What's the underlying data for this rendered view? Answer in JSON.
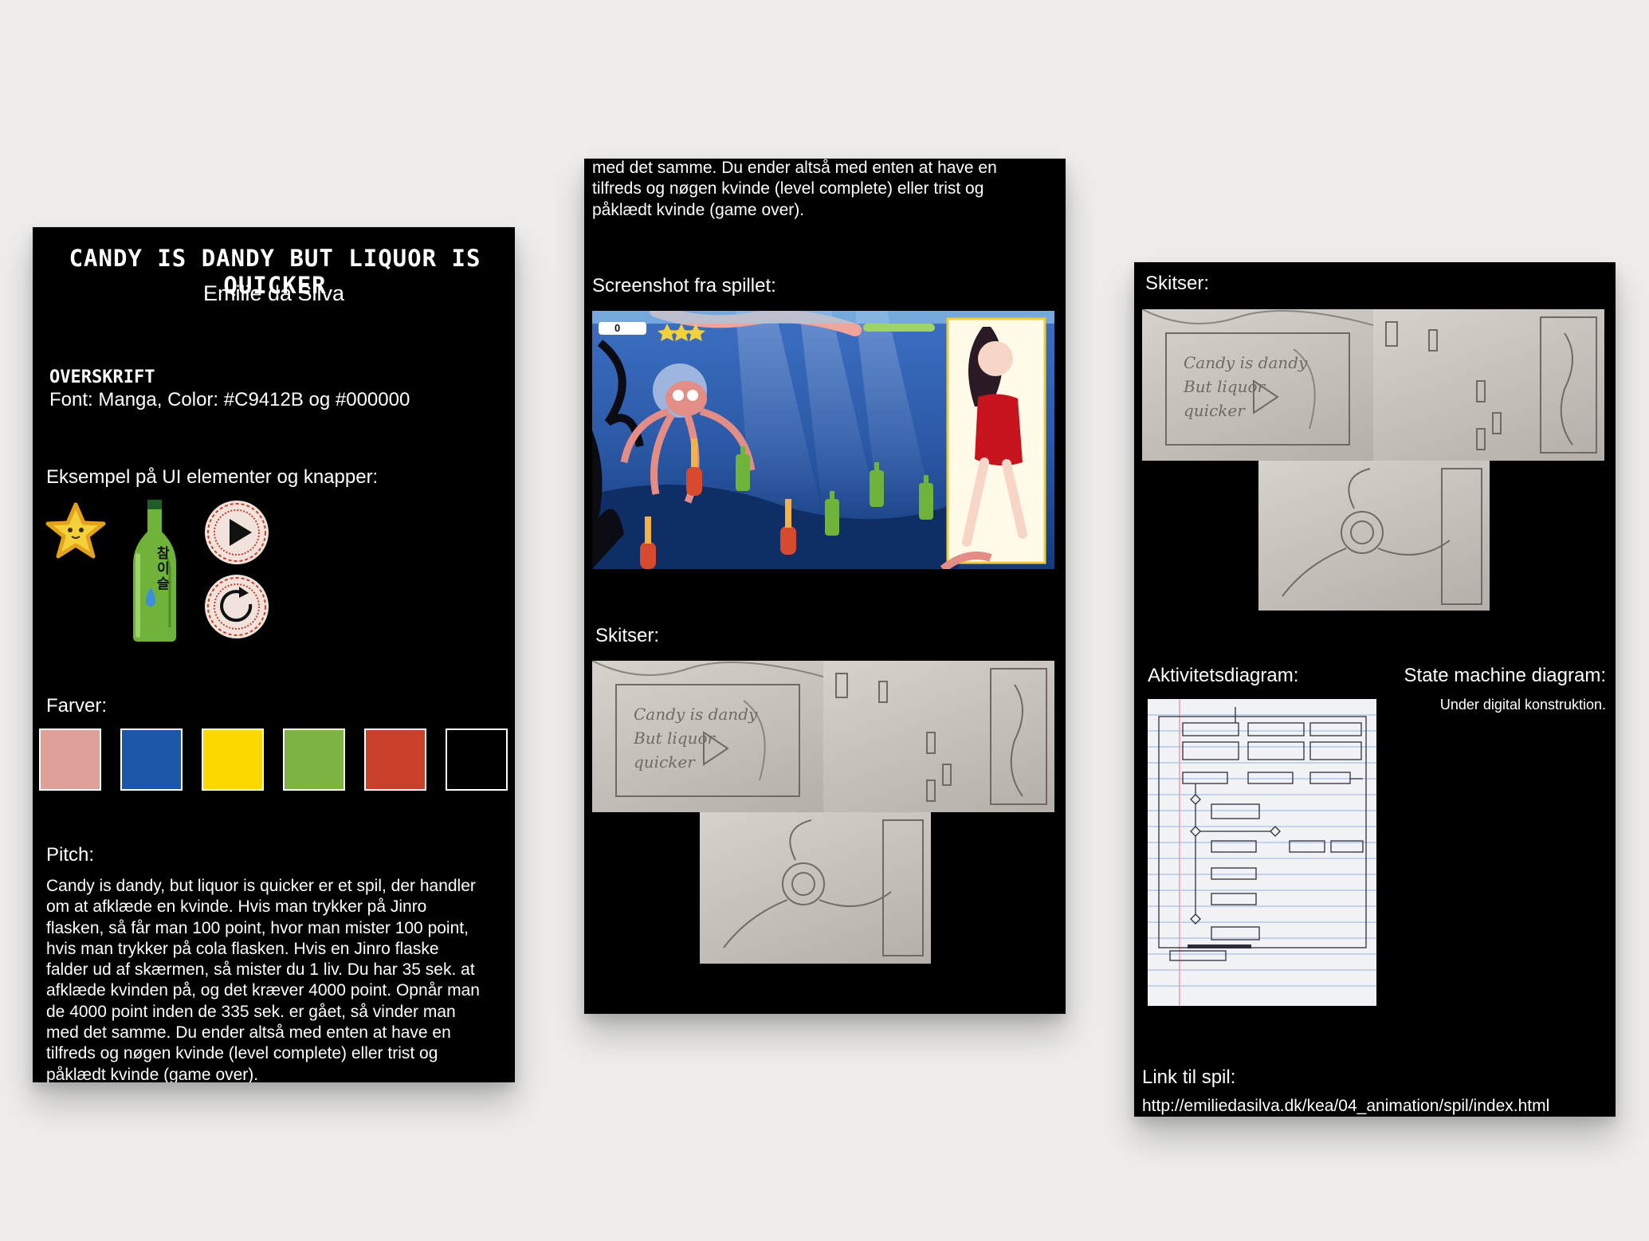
{
  "panel1": {
    "title": "Candy is dandy but liquor is quicker",
    "author": "Emilie da Silva",
    "heading_section": {
      "label": "Overskrift",
      "font_line": "Font: Manga, Color: #C9412B og #000000"
    },
    "ui_section": {
      "label": "Eksempel på UI elementer og knapper:",
      "bottle_label": "참이슬"
    },
    "colors_section": {
      "label": "Farver:",
      "swatches": [
        "#E0A09A",
        "#1C56A8",
        "#FDD800",
        "#7CB342",
        "#C9412B",
        "#000000"
      ]
    },
    "pitch_section": {
      "label": "Pitch:",
      "lines": [
        "Candy is dandy, but liquor is quicker er et spil, der handler",
        "om at afklæde en kvinde. Hvis man trykker på Jinro",
        "flasken, så får man 100 point, hvor man mister 100 point,",
        "hvis man trykker på cola flasken. Hvis en Jinro flaske",
        "falder ud af skærmen, så mister du 1 liv. Du har 35 sek. at",
        "afklæde kvinden på, og det kræver 4000 point. Opnår man",
        "de 4000 point inden de 335 sek. er gået, så vinder man",
        "med det samme. Du ender altså med enten at have en",
        "tilfreds og nøgen kvinde (level complete) eller trist og",
        "påklædt kvinde (game over)."
      ]
    }
  },
  "panel2": {
    "intro_lines": [
      "med det samme. Du ender altså med enten at have en",
      "tilfreds og nøgen kvinde (level complete) eller trist og",
      "påklædt kvinde (game over)."
    ],
    "screenshot_label": "Screenshot fra spillet:",
    "score": "0",
    "sketches_label": "Skitser:",
    "sketch_text": [
      "Candy is dandy",
      "But liquor",
      "quicker"
    ]
  },
  "panel3": {
    "sketches_label": "Skitser:",
    "sketch_text": [
      "Candy is dandy",
      "But liquor",
      "quicker"
    ],
    "activity_label": "Aktivitetsdiagram:",
    "state_label": "State machine diagram:",
    "state_note": "Under digital konstruktion.",
    "link_label": "Link til spil:",
    "link_url": "http://emiliedasilva.dk/kea/04_animation/spil/index.html"
  },
  "colors": {
    "background": "#EEEDEB",
    "panel": "#000000",
    "accent_red": "#C9412B"
  },
  "icons": [
    "star-icon",
    "soju-bottle-icon",
    "play-icon",
    "restart-icon",
    "octopus-icon"
  ]
}
